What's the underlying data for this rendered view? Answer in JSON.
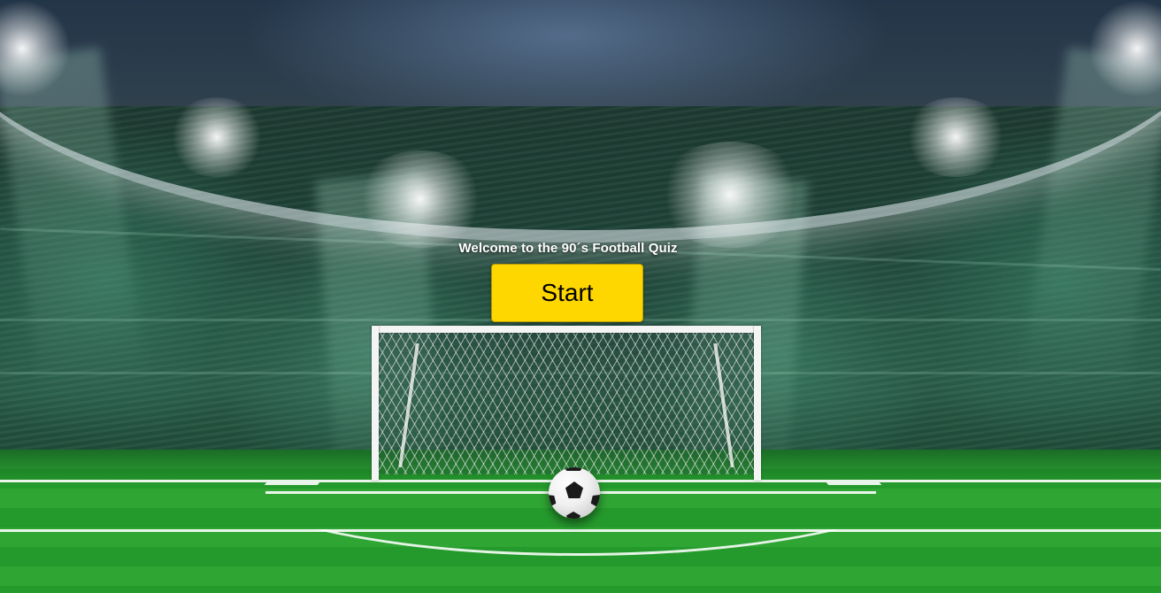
{
  "quiz": {
    "welcome_text": "Welcome to the 90´s Football Quiz",
    "start_label": "Start"
  },
  "colors": {
    "start_button": "#ffd700",
    "pitch_green": "#2a9f30",
    "title_text": "#ffffff"
  },
  "background": {
    "icon": "stadium-scene-with-goal-and-ball-icon"
  }
}
